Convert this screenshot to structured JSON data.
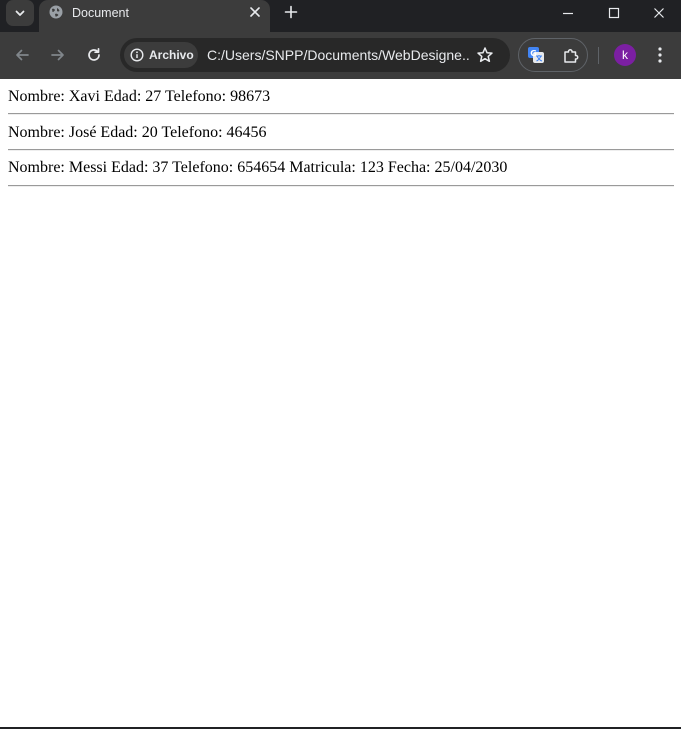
{
  "browser": {
    "tab": {
      "title": "Document"
    },
    "omnibox": {
      "chip_label": "Archivo",
      "url": "C:/Users/SNPP/Documents/WebDesigne..."
    },
    "profile": {
      "initial": "k"
    }
  },
  "page": {
    "records": [
      {
        "text": "Nombre: Xavi Edad: 27 Telefono: 98673"
      },
      {
        "text": "Nombre: José Edad: 20 Telefono: 46456"
      },
      {
        "text": "Nombre: Messi Edad: 37 Telefono: 654654 Matricula: 123 Fecha: 25/04/2030"
      }
    ]
  }
}
